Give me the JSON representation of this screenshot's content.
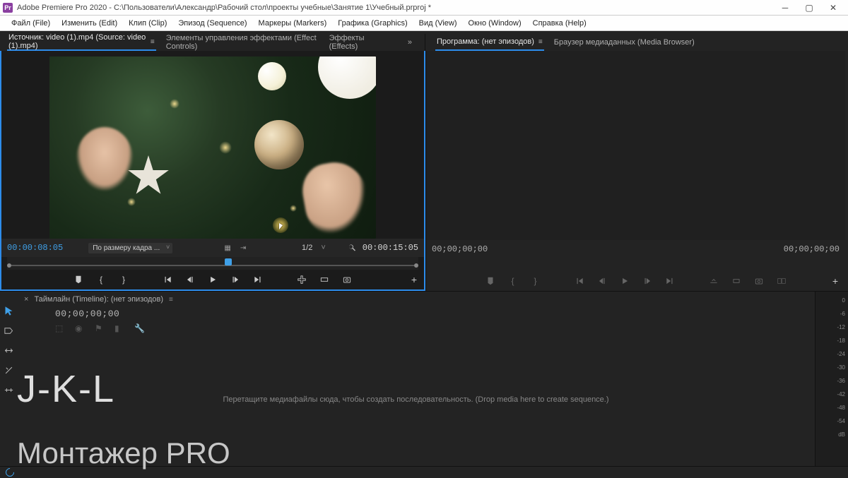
{
  "window": {
    "app_icon_text": "Pr",
    "title": "Adobe Premiere Pro 2020 - C:\\Пользователи\\Александр\\Рабочий стол\\проекты учебные\\Занятие 1\\Учебный.prproj *"
  },
  "menu": {
    "items": [
      "Файл (File)",
      "Изменить (Edit)",
      "Клип (Clip)",
      "Эпизод (Sequence)",
      "Маркеры (Markers)",
      "Графика (Graphics)",
      "Вид (View)",
      "Окно (Window)",
      "Справка (Help)"
    ]
  },
  "source_tabs": {
    "active": "Источник: video (1).mp4 (Source: video (1).mp4)",
    "others": [
      "Элементы управления эффектами (Effect Controls)",
      "Эффекты (Effects)"
    ]
  },
  "program_tabs": {
    "active": "Программа: (нет эпизодов)",
    "others": [
      "Браузер медиаданных (Media Browser)"
    ]
  },
  "source": {
    "current_tc": "00:00:08:05",
    "fit_label": "По размеру кадра ...",
    "ratio": "1/2",
    "duration_tc": "00:00:15:05"
  },
  "program": {
    "current_tc": "00;00;00;00",
    "duration_tc": "00;00;00;00"
  },
  "timeline": {
    "tab_label": "Таймлайн (Timeline): (нет эпизодов)",
    "current_tc": "00;00;00;00",
    "drop_hint": "Перетащите медиафайлы сюда, чтобы создать последовательность. (Drop media here to create sequence.)"
  },
  "audio_levels": [
    "0",
    "-6",
    "-12",
    "-18",
    "-24",
    "-30",
    "-36",
    "-42",
    "-48",
    "-54",
    "dB"
  ],
  "overlay": {
    "jkl": "J-K-L",
    "brand": "Монтажер PRO"
  }
}
